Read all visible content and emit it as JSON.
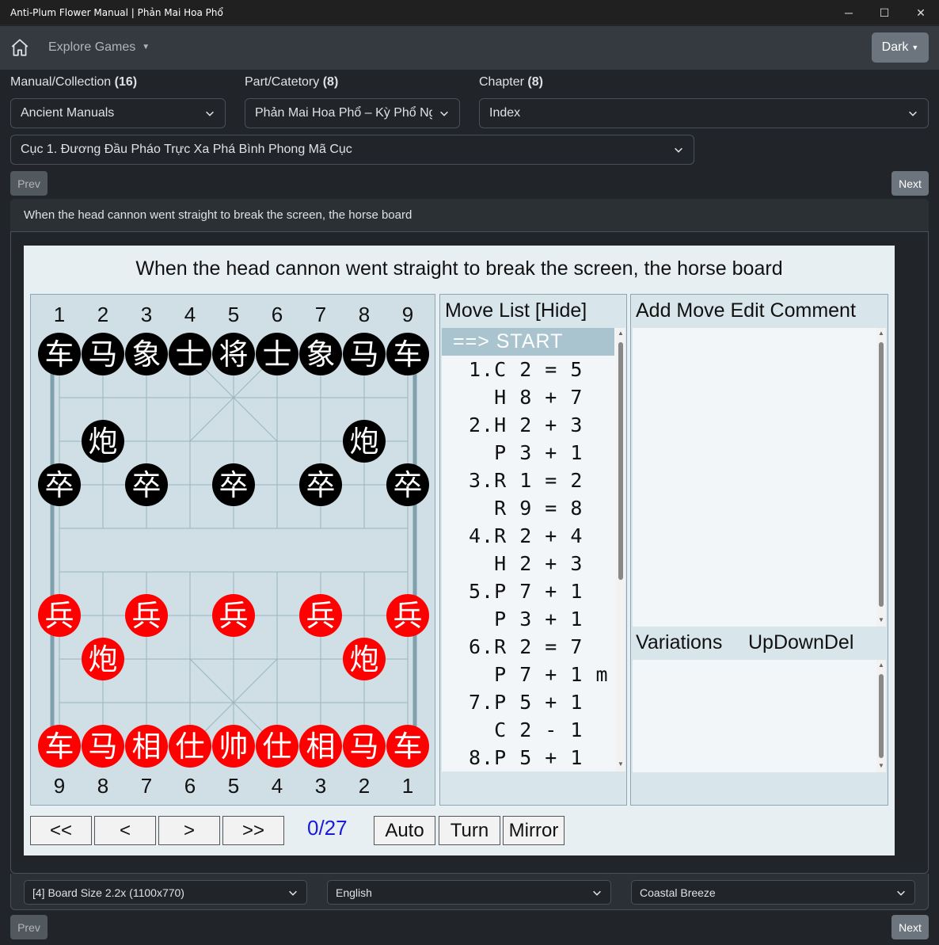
{
  "window": {
    "title": "Anti-Plum Flower Manual | Phản Mai Hoa Phổ",
    "minimize": "─",
    "maximize": "☐",
    "close": "✕"
  },
  "nav": {
    "home_icon": "home-icon",
    "explore": "Explore Games",
    "theme": "Dark"
  },
  "selectors": {
    "manual_label": "Manual/Collection",
    "manual_count": "(16)",
    "manual_value": "Ancient Manuals",
    "part_label": "Part/Catetory",
    "part_count": "(8)",
    "part_value": "Phản Mai Hoa Phổ – Kỳ Phổ Ngoại",
    "chapter_label": "Chapter",
    "chapter_count": "(8)",
    "chapter_value": "Index",
    "game_value": "Cục 1. Đương Đầu Pháo Trực Xa Phá Bình Phong Mã Cục"
  },
  "paging": {
    "prev": "Prev",
    "next": "Next"
  },
  "card": {
    "header": "When the head cannon went straight to break the screen, the horse board"
  },
  "viewer": {
    "title": "When the head cannon went straight to break the screen, the horse board",
    "top_files": [
      "1",
      "2",
      "3",
      "4",
      "5",
      "6",
      "7",
      "8",
      "9"
    ],
    "bottom_files": [
      "9",
      "8",
      "7",
      "6",
      "5",
      "4",
      "3",
      "2",
      "1"
    ],
    "movelist_title": "Move List [Hide]",
    "moves": [
      "==> START",
      "1.C 2 = 5",
      "  H 8 + 7",
      "2.H 2 + 3",
      "  P 3 + 1",
      "3.R 1 = 2",
      "  R 9 = 8",
      "4.R 2 + 4",
      "  H 2 + 3",
      "5.P 7 + 1",
      "  P 3 + 1",
      "6.R 2 = 7",
      "  P 7 + 1 m",
      "7.P 5 + 1",
      "  C 2 - 1",
      "8.P 5 + 1"
    ],
    "comment_title": "Add Move Edit Comment",
    "variations_title": "Variations",
    "variations_actions": "UpDownDel",
    "controls": {
      "first": "<<",
      "prev": "<",
      "next": ">",
      "last": ">>",
      "counter": "0/27",
      "auto": "Auto",
      "turn": "Turn",
      "mirror": "Mirror"
    },
    "black_back": [
      "车",
      "马",
      "象",
      "士",
      "将",
      "士",
      "象",
      "马",
      "车"
    ],
    "black_cannon": "炮",
    "black_soldier": "卒",
    "red_back": [
      "车",
      "马",
      "相",
      "仕",
      "帅",
      "仕",
      "相",
      "马",
      "车"
    ],
    "red_cannon": "炮",
    "red_soldier": "兵"
  },
  "footer": {
    "board_size": "[4] Board Size 2.2x (1100x770)",
    "language": "English",
    "theme": "Coastal Breeze"
  }
}
